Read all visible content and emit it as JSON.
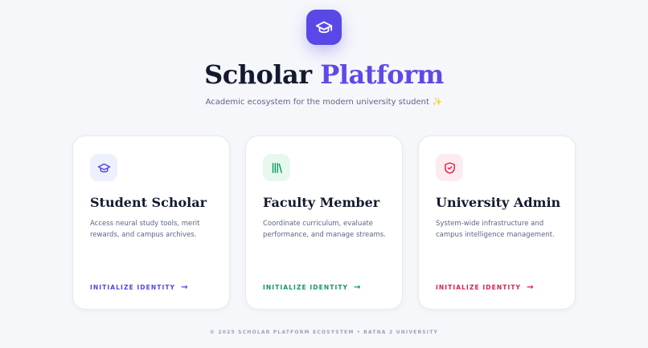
{
  "header": {
    "logo_icon": "graduation-cap-icon",
    "title_main": "Scholar",
    "title_accent": "Platform",
    "subtitle": "Academic ecosystem for the modern university student",
    "subtitle_emoji": "✨"
  },
  "cards": [
    {
      "icon": "graduation-cap-icon",
      "title": "Student Scholar",
      "description": "Access neural study tools, merit rewards, and campus archives.",
      "link_label": "INITIALIZE IDENTITY",
      "link_arrow": "→",
      "accent_color": "#4f46e5",
      "icon_bg": "#eef0fd"
    },
    {
      "icon": "library-icon",
      "title": "Faculty Member",
      "description": "Coordinate curriculum, evaluate performance, and manage streams.",
      "link_label": "INITIALIZE IDENTITY",
      "link_arrow": "→",
      "accent_color": "#0f9a5c",
      "icon_bg": "#e7f8ef"
    },
    {
      "icon": "shield-check-icon",
      "title": "University Admin",
      "description": "System-wide infrastructure and campus intelligence management.",
      "link_label": "INITIALIZE IDENTITY",
      "link_arrow": "→",
      "accent_color": "#e11d48",
      "icon_bg": "#fdecef"
    }
  ],
  "footer": {
    "text": "© 2025 SCHOLAR PLATFORM ECOSYSTEM • BATNA 2 UNIVERSITY"
  },
  "colors": {
    "brand": "#5a48e6",
    "background": "#f5f7fb",
    "heading": "#141a2e",
    "muted": "#5b6684"
  }
}
